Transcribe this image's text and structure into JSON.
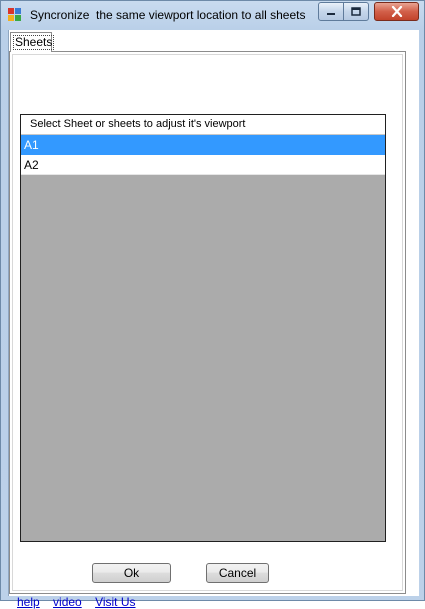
{
  "window": {
    "title": "Syncronize  the same viewport location to all sheets"
  },
  "tabs": [
    {
      "label": "Sheets",
      "active": true
    }
  ],
  "sheet_list": {
    "header": "Select Sheet or sheets to adjust it's viewport",
    "items": [
      {
        "label": "A1",
        "selected": true
      },
      {
        "label": "A2",
        "selected": false
      }
    ]
  },
  "buttons": {
    "ok_label": "Ok",
    "cancel_label": "Cancel"
  },
  "links": {
    "help": "help",
    "video": "video",
    "visit": "Visit Us"
  },
  "colors": {
    "selection": "#3399ff",
    "list_background": "#ababab",
    "link": "#0000cc"
  }
}
